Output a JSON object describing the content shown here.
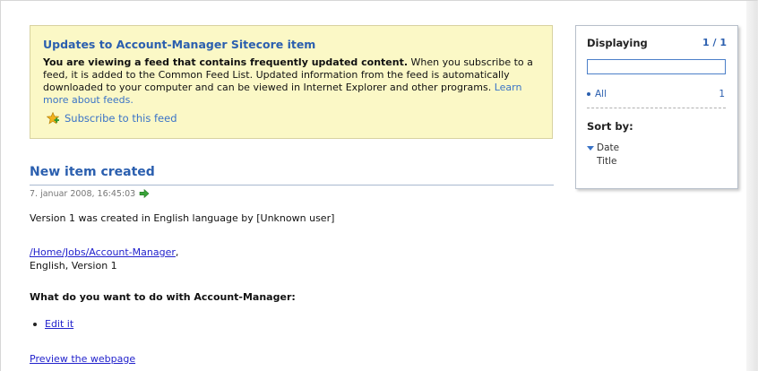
{
  "info_box": {
    "title": "Updates to Account-Manager Sitecore item",
    "text_bold": "You are viewing a feed that contains frequently updated content.",
    "text_rest": " When you subscribe to a feed, it is added to the Common Feed List. Updated information from the feed is automatically downloaded to your computer and can be viewed in Internet Explorer and other programs. ",
    "learn_more_link": "Learn more about feeds.",
    "subscribe_link": "Subscribe to this feed",
    "subscribe_icon": "star-plus-icon"
  },
  "item": {
    "title": "New item created",
    "timestamp": "7. januar 2008, 16:45:03",
    "go_icon": "green-arrow-icon",
    "version_text": "Version 1 was created in English language by [Unknown user]",
    "path_link": "/Home/Jobs/Account-Manager",
    "path_suffix": ",",
    "lang_version": "English, Version 1",
    "question": "What do you want to do with Account-Manager:",
    "actions": [
      "Edit it"
    ],
    "preview_link": "Preview the webpage"
  },
  "sidebar": {
    "displaying_label": "Displaying",
    "count": "1 / 1",
    "search_value": "",
    "filter_all_label": "All",
    "filter_all_count": "1",
    "sort_by_label": "Sort by:",
    "sort_options": [
      "Date",
      "Title"
    ],
    "active_sort": "Date"
  },
  "colors": {
    "link_blue": "#2b5faf",
    "info_bg": "#fbf8c6",
    "hyperlink": "#2222cc"
  }
}
